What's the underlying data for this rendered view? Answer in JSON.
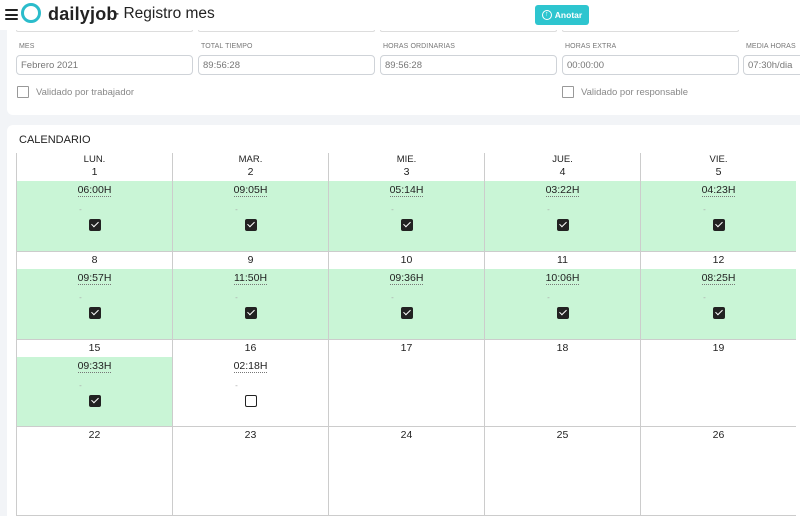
{
  "header": {
    "brand": "dailyjob",
    "title": "- Registro mes",
    "anotar_label": "Anotar"
  },
  "summary": {
    "fields": [
      {
        "label": "MES",
        "value": "Febrero 2021"
      },
      {
        "label": "TOTAL TIEMPO",
        "value": "89:56:28"
      },
      {
        "label": "HORAS ORDINARIAS",
        "value": "89:56:28"
      },
      {
        "label": "HORAS EXTRA",
        "value": "00:00:00"
      },
      {
        "label": "MEDIA HORAS",
        "value": "07:30h/dia"
      }
    ],
    "validado_trabajador": "Validado por trabajador",
    "validado_responsable": "Validado por responsable"
  },
  "calendar": {
    "title": "CALENDARIO",
    "days": [
      {
        "label": "LUN.",
        "num": "1"
      },
      {
        "label": "MAR.",
        "num": "2"
      },
      {
        "label": "MIE.",
        "num": "3"
      },
      {
        "label": "JUE.",
        "num": "4"
      },
      {
        "label": "VIE.",
        "num": "5"
      }
    ],
    "weeks": [
      [
        {
          "num": "",
          "time": "06:00H",
          "dash": "-",
          "checked": true
        },
        {
          "num": "",
          "time": "09:05H",
          "dash": "-",
          "checked": true
        },
        {
          "num": "",
          "time": "05:14H",
          "dash": "-",
          "checked": true
        },
        {
          "num": "",
          "time": "03:22H",
          "dash": "-",
          "checked": true
        },
        {
          "num": "",
          "time": "04:23H",
          "dash": "-",
          "checked": true
        }
      ],
      [
        {
          "num": "8",
          "time": "09:57H",
          "dash": "-",
          "checked": true
        },
        {
          "num": "9",
          "time": "11:50H",
          "dash": "-",
          "checked": true
        },
        {
          "num": "10",
          "time": "09:36H",
          "dash": "-",
          "checked": true
        },
        {
          "num": "11",
          "time": "10:06H",
          "dash": "-",
          "checked": true
        },
        {
          "num": "12",
          "time": "08:25H",
          "dash": "-",
          "checked": true
        }
      ],
      [
        {
          "num": "15",
          "time": "09:33H",
          "dash": "-",
          "checked": true
        },
        {
          "num": "16",
          "time": "02:18H",
          "dash": "-",
          "checked": false
        },
        {
          "num": "17"
        },
        {
          "num": "18"
        },
        {
          "num": "19"
        }
      ],
      [
        {
          "num": "22"
        },
        {
          "num": "23"
        },
        {
          "num": "24"
        },
        {
          "num": "25"
        },
        {
          "num": "26"
        }
      ]
    ]
  }
}
